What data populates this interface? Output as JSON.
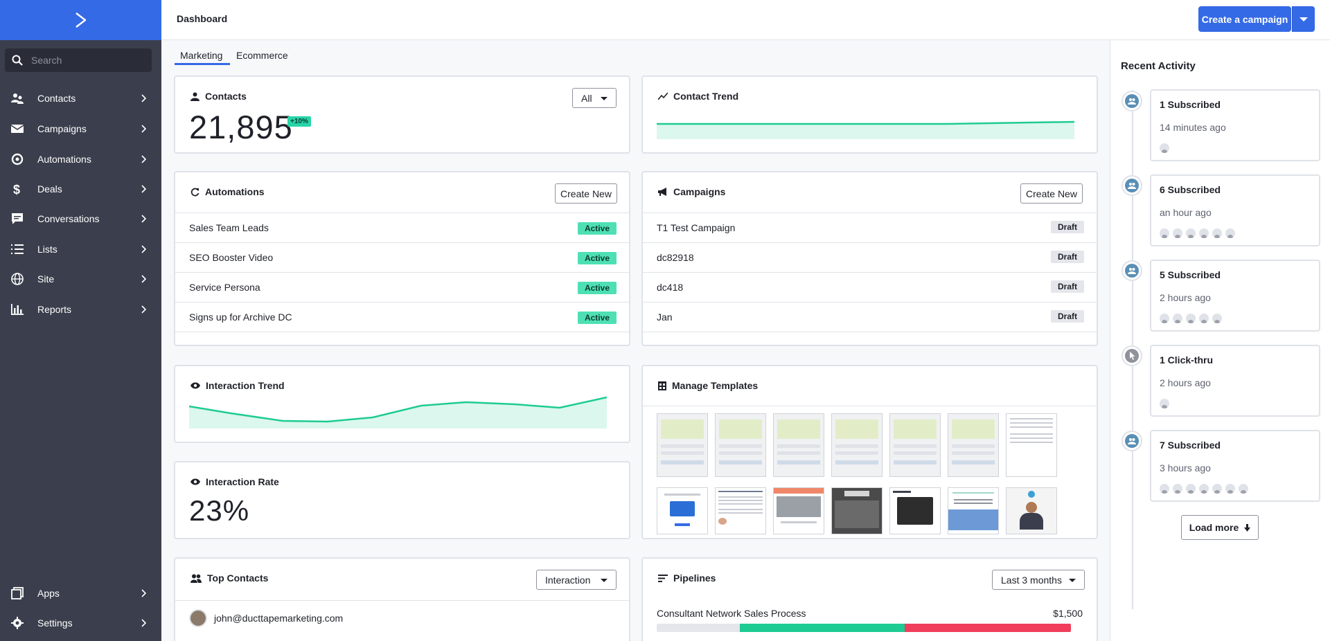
{
  "sidebar": {
    "logo": "activecampaign-logo",
    "search_placeholder": "Search",
    "items": [
      {
        "label": "Contacts",
        "icon": "contacts-icon"
      },
      {
        "label": "Campaigns",
        "icon": "envelope-icon"
      },
      {
        "label": "Automations",
        "icon": "automations-icon"
      },
      {
        "label": "Deals",
        "icon": "dollar-icon"
      },
      {
        "label": "Conversations",
        "icon": "chat-icon"
      },
      {
        "label": "Lists",
        "icon": "list-icon"
      },
      {
        "label": "Site",
        "icon": "globe-icon"
      },
      {
        "label": "Reports",
        "icon": "bar-chart-icon"
      }
    ],
    "bottom_items": [
      {
        "label": "Apps",
        "icon": "apps-icon"
      },
      {
        "label": "Settings",
        "icon": "gear-icon"
      }
    ]
  },
  "header": {
    "title": "Dashboard",
    "create_label": "Create a campaign"
  },
  "tabs": [
    {
      "label": "Marketing",
      "active": true
    },
    {
      "label": "Ecommerce",
      "active": false
    }
  ],
  "contacts_card": {
    "title": "Contacts",
    "count": "21,895",
    "change": "+10%",
    "filter": "All"
  },
  "contact_trend": {
    "title": "Contact Trend"
  },
  "automations": {
    "title": "Automations",
    "create_label": "Create New",
    "rows": [
      {
        "name": "Sales Team Leads",
        "status": "Active"
      },
      {
        "name": "SEO Booster Video",
        "status": "Active"
      },
      {
        "name": "Service Persona",
        "status": "Active"
      },
      {
        "name": "Signs up for Archive DC",
        "status": "Active"
      }
    ]
  },
  "campaigns": {
    "title": "Campaigns",
    "create_label": "Create New",
    "rows": [
      {
        "name": "T1 Test Campaign",
        "status": "Draft"
      },
      {
        "name": "dc82918",
        "status": "Draft"
      },
      {
        "name": "dc418",
        "status": "Draft"
      },
      {
        "name": "Jan",
        "status": "Draft"
      }
    ]
  },
  "interaction_trend": {
    "title": "Interaction Trend"
  },
  "interaction_rate": {
    "title": "Interaction Rate",
    "value": "23%"
  },
  "templates": {
    "title": "Manage Templates"
  },
  "top_contacts": {
    "title": "Top Contacts",
    "filter": "Interaction",
    "rows": [
      {
        "email": "john@ducttapemarketing.com"
      }
    ]
  },
  "pipelines": {
    "title": "Pipelines",
    "filter": "Last 3 months",
    "rows": [
      {
        "name": "Consultant Network Sales Process",
        "value": "$1,500"
      }
    ]
  },
  "recent_activity": {
    "title": "Recent Activity",
    "items": [
      {
        "label": "1 Subscribed",
        "time": "14 minutes ago",
        "avatars": 1,
        "kind": "subscribe"
      },
      {
        "label": "6 Subscribed",
        "time": "an hour ago",
        "avatars": 6,
        "kind": "subscribe"
      },
      {
        "label": "5 Subscribed",
        "time": "2 hours ago",
        "avatars": 5,
        "kind": "subscribe"
      },
      {
        "label": "1 Click-thru",
        "time": "2 hours ago",
        "avatars": 1,
        "kind": "click"
      },
      {
        "label": "7 Subscribed",
        "time": "3 hours ago",
        "avatars": 7,
        "kind": "subscribe"
      }
    ],
    "load_more": "Load more"
  },
  "colors": {
    "accent": "#356ae6",
    "sidebar": "#3b3f4d",
    "trend_line": "#1ecb92",
    "trend_fill": "#dbf7ee",
    "active_badge": "#4ee0b4",
    "pipeline_gray": "#e4e6eb",
    "pipeline_green": "#1ecb92",
    "pipeline_red": "#f03e5c"
  }
}
